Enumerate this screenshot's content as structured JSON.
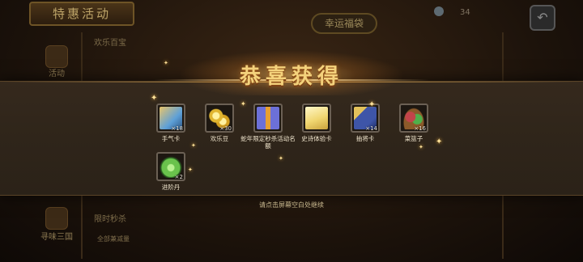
{
  "background": {
    "header_title": "特惠活动",
    "shop_sign": "幸运福袋",
    "top_count": "34",
    "back_icon": "back-arrow-icon",
    "side_nav": [
      {
        "label": "活动",
        "icon": "gift-icon"
      },
      {
        "label": "寻味三国",
        "icon": "noodle-bowl-icon"
      }
    ],
    "side_texts": [
      "欢乐百宝",
      "限时秒杀",
      "全部兼减量"
    ]
  },
  "reward": {
    "title": "恭喜获得",
    "items": [
      {
        "label": "手气卡",
        "qty": "×18",
        "icon": "luck-card-icon",
        "color": "#5ea0d8"
      },
      {
        "label": "欢乐豆",
        "qty": "×30",
        "icon": "gold-beans-icon",
        "color": "#e0b530"
      },
      {
        "label": "蛇年限定秒杀活动名额",
        "qty": "",
        "icon": "gift-box-icon",
        "color": "#6c70d8"
      },
      {
        "label": "史诗体验卡",
        "qty": "",
        "icon": "epic-card-icon",
        "color": "#f0d670"
      },
      {
        "label": "抽将卡",
        "qty": "×14",
        "icon": "draw-general-card-icon",
        "color": "#3e55a8"
      },
      {
        "label": "菜篮子",
        "qty": "×16",
        "icon": "vegetable-basket-icon",
        "color": "#c2444a"
      },
      {
        "label": "进阶丹",
        "qty": "×2",
        "icon": "advance-pill-icon",
        "color": "#6ac24c"
      }
    ],
    "hint": "请点击屏幕空白处继续"
  }
}
